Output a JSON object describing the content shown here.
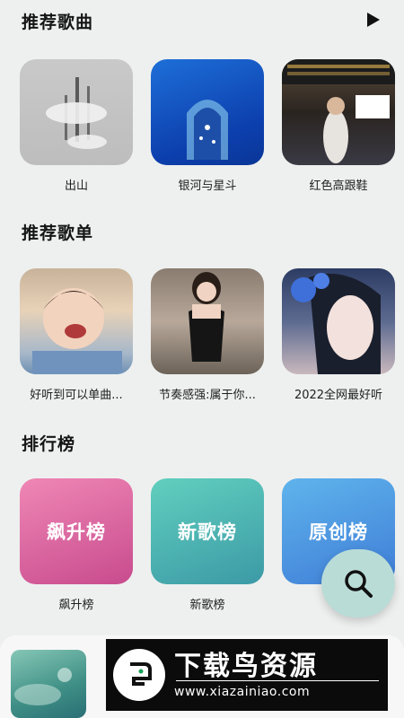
{
  "sections": {
    "recommended_songs": "推荐歌曲",
    "recommended_playlists": "推荐歌单",
    "charts": "排行榜"
  },
  "songs": [
    {
      "title": "出山"
    },
    {
      "title": "银河与星斗"
    },
    {
      "title": "红色高跟鞋"
    }
  ],
  "playlists": [
    {
      "title": "好听到可以单曲..."
    },
    {
      "title": "节奏感强:属于你..."
    },
    {
      "title": "2022全网最好听"
    }
  ],
  "ranks": [
    {
      "tile": "飙升榜",
      "caption": "飙升榜"
    },
    {
      "tile": "新歌榜",
      "caption": "新歌榜"
    },
    {
      "tile": "原创榜",
      "caption": "原"
    }
  ],
  "watermark": {
    "title": "下载鸟资源",
    "url": "www.xiazainiao.com"
  },
  "icons": {
    "play": "play-icon",
    "search": "search-icon"
  },
  "colors": {
    "background": "#eef0ef",
    "fab": "#b9dcd7"
  }
}
